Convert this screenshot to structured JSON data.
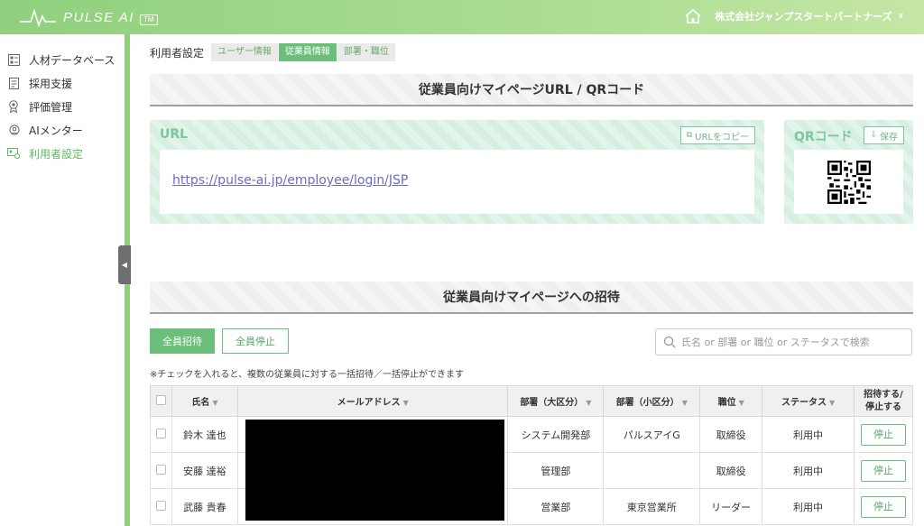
{
  "header": {
    "logo_text": "PULSE AI",
    "logo_tm": "TM",
    "company": "株式会社ジャンプスタートパートナーズ",
    "brand_color": "#8fd07e"
  },
  "sidebar": {
    "items": [
      {
        "label": "人材データベース",
        "icon": "database-icon"
      },
      {
        "label": "採用支援",
        "icon": "document-icon"
      },
      {
        "label": "評価管理",
        "icon": "award-icon"
      },
      {
        "label": "AIメンター",
        "icon": "mentor-icon"
      },
      {
        "label": "利用者設定",
        "icon": "user-settings-icon",
        "active": true
      }
    ]
  },
  "breadcrumb": {
    "label": "利用者設定",
    "tabs": [
      "ユーザー情報",
      "従業員情報",
      "部署・職位"
    ],
    "active_tab": "従業員情報"
  },
  "url_section": {
    "title": "従業員向けマイページURL / QRコード",
    "url_label": "URL",
    "copy_button": "URLをコピー",
    "url": "https://pulse-ai.jp/employee/login/JSP",
    "qr_label": "QRコード",
    "save_button": "保存"
  },
  "invite_section": {
    "title": "従業員向けマイページへの招待",
    "invite_all": "全員招待",
    "stop_all": "全員停止",
    "search_placeholder": "氏名 or 部署 or 職位 or ステータスで検索",
    "note": "※チェックを入れると、複数の従業員に対する一括招待／一括停止ができます",
    "columns": {
      "name": "氏名",
      "email": "メールアドレス",
      "dept_major": "部署（大区分）",
      "dept_minor": "部署（小区分）",
      "position": "職位",
      "status": "ステータス",
      "action_line1": "招待する/",
      "action_line2": "停止する"
    },
    "rows": [
      {
        "name": "鈴木 達也",
        "dept_major": "システム開発部",
        "dept_minor": "パルスアイG",
        "position": "取締役",
        "status": "利用中",
        "action": "停止"
      },
      {
        "name": "安藤 達裕",
        "dept_major": "管理部",
        "dept_minor": "",
        "position": "取締役",
        "status": "利用中",
        "action": "停止"
      },
      {
        "name": "武藤 貴春",
        "dept_major": "営業部",
        "dept_minor": "東京営業所",
        "position": "リーダー",
        "status": "利用中",
        "action": "停止"
      }
    ]
  }
}
